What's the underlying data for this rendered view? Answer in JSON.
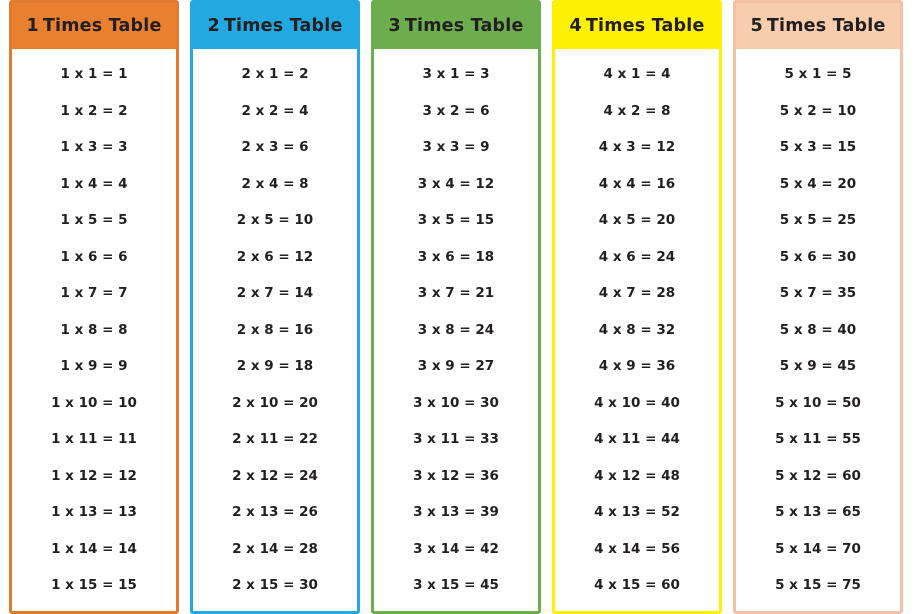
{
  "page": {
    "title": "Times Tables 1 to 5",
    "background": "#ffffff"
  },
  "tables": [
    {
      "id": "times-table-1",
      "factor": "1",
      "heading": "1 Times Table",
      "heading_number": "1",
      "heading_label": "Times  Table",
      "header_bg": "#e98030",
      "border_color": "#e07b2f",
      "header_text_color": "#231f20",
      "rows": [
        "1 x 1 = 1",
        "1 x 2 = 2",
        "1 x 3 = 3",
        "1 x 4 = 4",
        "1 x 5 = 5",
        "1 x 6 = 6",
        "1 x 7 = 7",
        "1 x 8 = 8",
        "1 x 9 = 9",
        "1 x 10 = 10",
        "1 x 11 = 11",
        "1 x 12 = 12",
        "1 x 13 = 13",
        "1 x 14 = 14",
        "1 x 15 = 15"
      ]
    },
    {
      "id": "times-table-2",
      "factor": "2",
      "heading": "2 Times Table",
      "heading_number": "2",
      "heading_label": "Times  Table",
      "header_bg": "#23a9e1",
      "border_color": "#23a9e1",
      "header_text_color": "#231f20",
      "rows": [
        "2 x 1 = 2",
        "2 x 2 = 4",
        "2 x 3 = 6",
        "2 x 4 = 8",
        "2 x 5 = 10",
        "2 x 6 = 12",
        "2 x 7 = 14",
        "2 x 8 = 16",
        "2 x 9 = 18",
        "2 x 10 = 20",
        "2 x 11 = 22",
        "2 x 12 = 24",
        "2 x 13 = 26",
        "2 x 14 = 28",
        "2 x 15 = 30"
      ]
    },
    {
      "id": "times-table-3",
      "factor": "3",
      "heading": "3 Times Table",
      "heading_number": "3",
      "heading_label": "Times  Table",
      "header_bg": "#6cad4d",
      "border_color": "#6cad4d",
      "header_text_color": "#231f20",
      "rows": [
        "3 x 1 = 3",
        "3 x 2 = 6",
        "3 x 3 = 9",
        "3 x 4 = 12",
        "3 x 5 = 15",
        "3 x 6 = 18",
        "3 x 7 = 21",
        "3 x 8 = 24",
        "3 x 9 = 27",
        "3 x 10 = 30",
        "3 x 11 = 33",
        "3 x 12 = 36",
        "3 x 13 = 39",
        "3 x 14 = 42",
        "3 x 15 = 45"
      ]
    },
    {
      "id": "times-table-4",
      "factor": "4",
      "heading": "4 Times Table",
      "heading_number": "4",
      "heading_label": "Times  Table",
      "header_bg": "#fdf000",
      "border_color": "#fdf000",
      "header_text_color": "#231f20",
      "rows": [
        "4 x 1 = 4",
        "4 x 2 = 8",
        "4 x 3 = 12",
        "4 x 4 = 16",
        "4 x 5 = 20",
        "4 x 6 = 24",
        "4 x 7 = 28",
        "4 x 8 = 32",
        "4 x 9 = 36",
        "4 x 10 = 40",
        "4 x 11 = 44",
        "4 x 12 = 48",
        "4 x 13 = 52",
        "4 x 14 = 56",
        "4 x 15 = 60"
      ]
    },
    {
      "id": "times-table-5",
      "factor": "5",
      "heading": "5 Times Table",
      "heading_number": "5",
      "heading_label": "Times  Table",
      "header_bg": "#f7cdae",
      "border_color": "#f2c3a2",
      "header_text_color": "#231f20",
      "rows": [
        "5 x 1 = 5",
        "5 x 2 = 10",
        "5 x 3 = 15",
        "5 x 4 = 20",
        "5 x 5 = 25",
        "5 x 6 = 30",
        "5 x 7 = 35",
        "5 x 8 = 40",
        "5 x 9 = 45",
        "5 x 10 = 50",
        "5 x 11 = 55",
        "5 x 12 = 60",
        "5 x 13 = 65",
        "5 x 14 = 70",
        "5 x 15 = 75"
      ]
    }
  ]
}
